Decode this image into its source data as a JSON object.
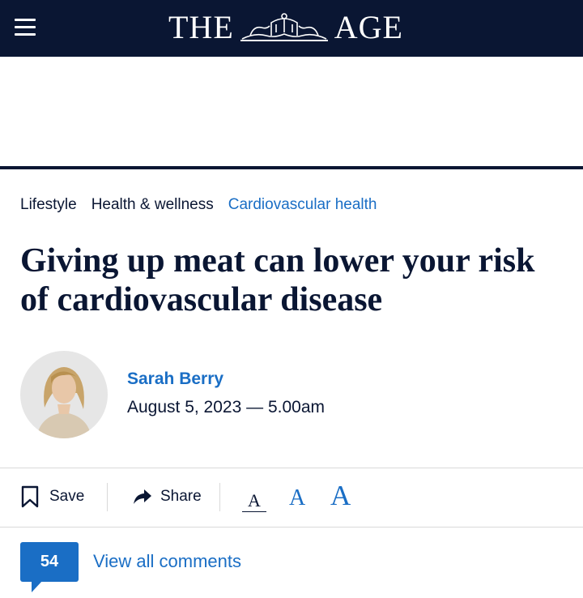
{
  "header": {
    "brand_left": "THE",
    "brand_right": "AGE",
    "menu_icon": "hamburger-menu-icon",
    "crest_icon": "coat-of-arms-crest",
    "background": "#0a1633"
  },
  "breadcrumbs": [
    {
      "label": "Lifestyle",
      "active": false
    },
    {
      "label": "Health & wellness",
      "active": false
    },
    {
      "label": "Cardiovascular health",
      "active": true
    }
  ],
  "article": {
    "headline": "Giving up meat can lower your risk of cardiovascular disease",
    "author": "Sarah Berry",
    "dateline": "August 5, 2023 — 5.00am"
  },
  "toolbar": {
    "save_label": "Save",
    "share_label": "Share",
    "font_sizes": [
      "A",
      "A",
      "A"
    ],
    "selected_font_size": "small"
  },
  "comments": {
    "count": "54",
    "link_label": "View all comments"
  },
  "colors": {
    "navy": "#0a1633",
    "link_blue": "#1a6ec5",
    "divider": "#d9d9d9"
  }
}
